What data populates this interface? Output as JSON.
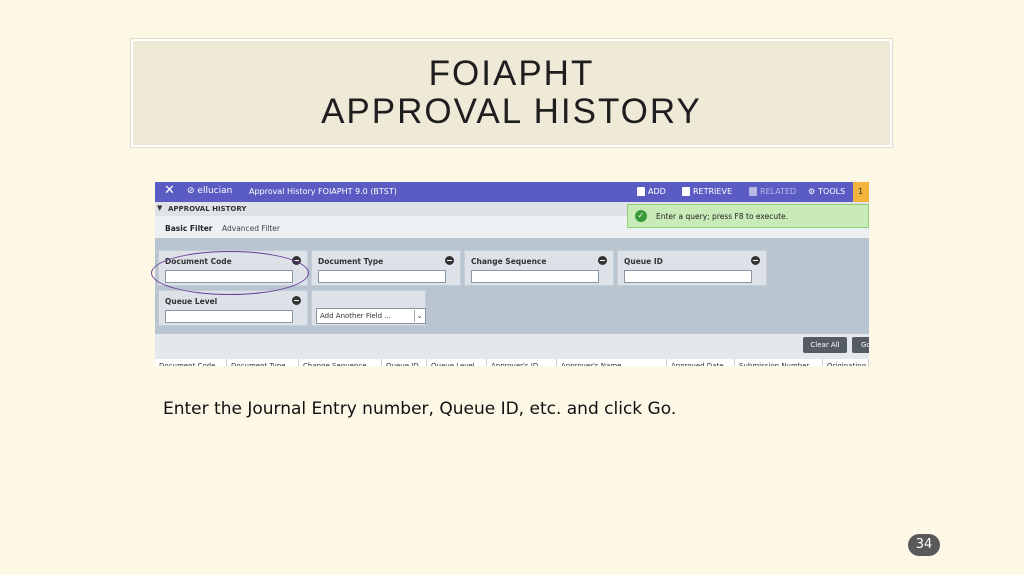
{
  "slide": {
    "title_line1": "FOIAPHT",
    "title_line2": "APPROVAL HISTORY",
    "caption": "Enter the Journal Entry number, Queue ID, etc. and click Go.",
    "page_number": "34"
  },
  "app": {
    "close_glyph": "✕",
    "logo": "ellucian",
    "title": "Approval History FOIAPHT 9.0 (BTST)",
    "toolbar": {
      "add": "ADD",
      "retrieve": "RETRIEVE",
      "related": "RELATED",
      "tools": "TOOLS",
      "badge": "1"
    },
    "section_label": "APPROVAL HISTORY",
    "notification": "Enter a query; press F8 to execute.",
    "filters": {
      "basic": "Basic Filter",
      "advanced": "Advanced Filter"
    },
    "fields": {
      "document_code": "Document Code",
      "document_type": "Document Type",
      "change_sequence": "Change Sequence",
      "queue_id": "Queue ID",
      "queue_level": "Queue Level"
    },
    "add_field": "Add Another Field ...",
    "buttons": {
      "clear_all": "Clear All",
      "go": "Go"
    },
    "columns": [
      "Document Code",
      "Document Type",
      "Change Sequence",
      "Queue ID",
      "Queue Level",
      "Approver's ID",
      "Approver's Name",
      "Approved Date",
      "Submission Number",
      "Originating"
    ]
  },
  "colors": {
    "accent": "#5a5cc4",
    "highlight_circle": "#6a3d9a",
    "success": "#3d9a3a"
  }
}
